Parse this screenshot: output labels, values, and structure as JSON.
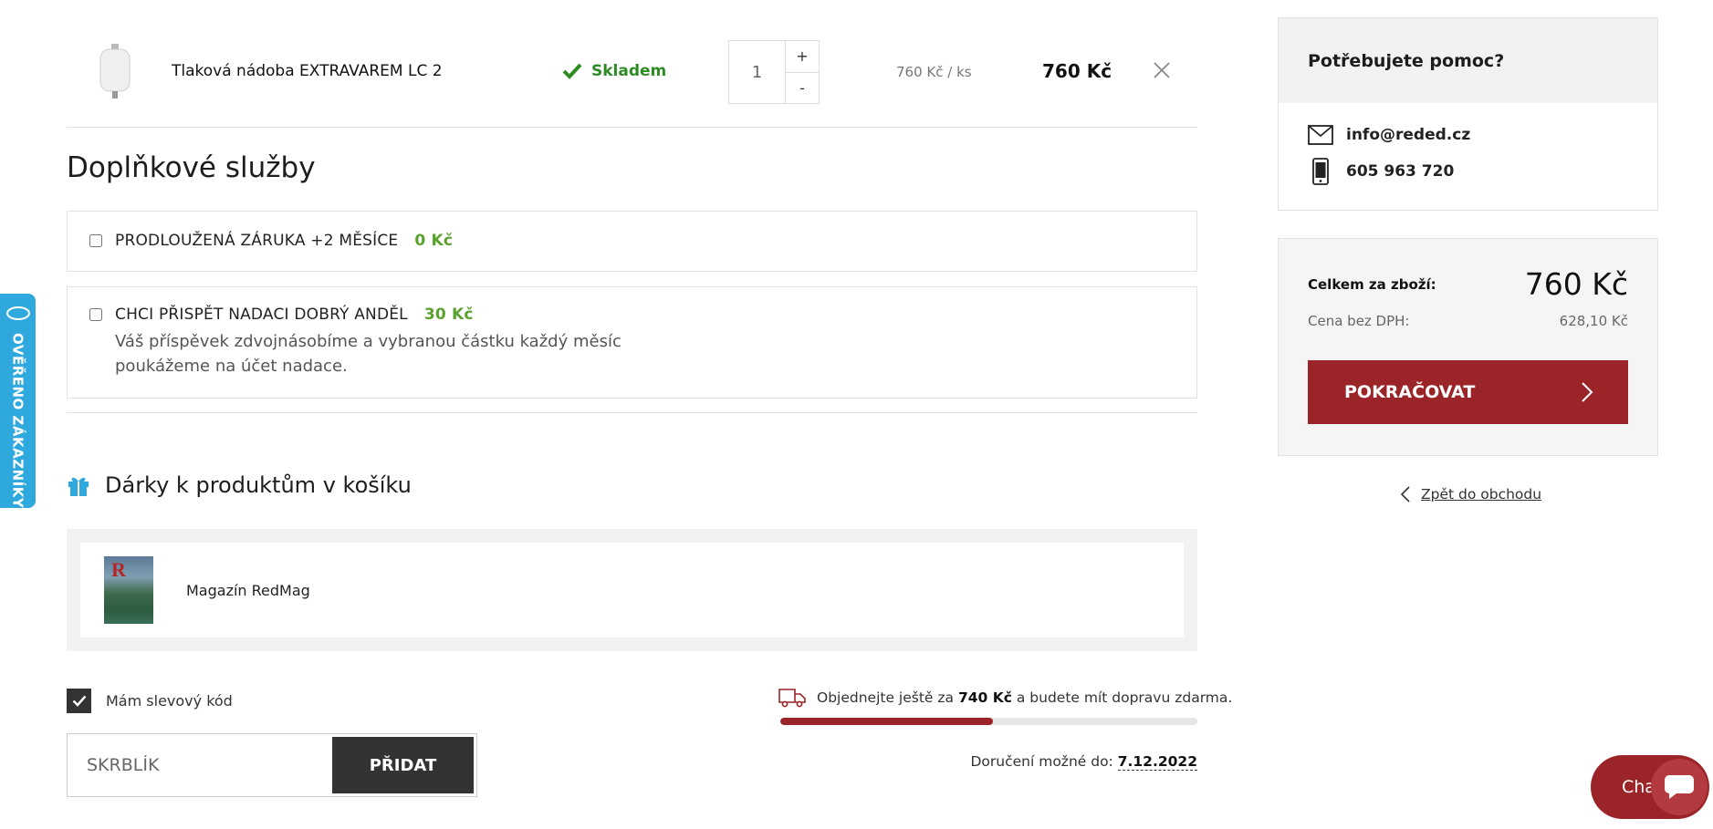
{
  "cart_item": {
    "name": "Tlaková nádoba EXTRAVAREM LC 2",
    "stock_label": "Skladem",
    "quantity": "1",
    "qty_plus": "+",
    "qty_minus": "-",
    "unit_price": "760 Kč / ks",
    "total_price": "760 Kč"
  },
  "services": {
    "title": "Doplňkové služby",
    "items": [
      {
        "label": "PRODLOUŽENÁ ZÁRUKA +2 MĚSÍCE",
        "price": "0 Kč",
        "checked": false
      },
      {
        "label": "CHCI PŘISPĚT NADACI DOBRÝ ANDĚL",
        "price": "30 Kč",
        "checked": false,
        "description": "Váš příspěvek zdvojnásobíme a vybranou částku každý měsíc poukážeme na účet nadace."
      }
    ]
  },
  "gifts": {
    "title": "Dárky k produktům v košíku",
    "items": [
      {
        "name": "Magazín RedMag",
        "logo_letter": "R"
      }
    ]
  },
  "coupon": {
    "checkbox_label": "Mám slevový kód",
    "checked": true,
    "input_value": "SKRBLÍK",
    "submit_label": "PŘIDAT"
  },
  "shipping": {
    "message_prefix": "Objednejte ještě za",
    "remaining": "740 Kč",
    "message_suffix": "a budete mít dopravu zdarma.",
    "progress_percent": 51,
    "delivery_label": "Doručení možné do:",
    "delivery_date": "7.12.2022"
  },
  "help": {
    "title": "Potřebujete pomoc?",
    "email": "info@reded.cz",
    "phone": "605 963 720"
  },
  "summary": {
    "total_label": "Celkem za zboží:",
    "total_value": "760 Kč",
    "net_label": "Cena bez DPH:",
    "net_value": "628,10 Kč",
    "continue_label": "POKRAČOVAT"
  },
  "back_link": "Zpět do obchodu",
  "verified_tab": "OVĚŘENO ZÁKAZNÍKY",
  "chat_label": "Chat",
  "colors": {
    "brand": "#9b2428",
    "in_stock": "#2e8b23",
    "service_price": "#5aa12e",
    "verified_tab": "#2fa9dd"
  }
}
